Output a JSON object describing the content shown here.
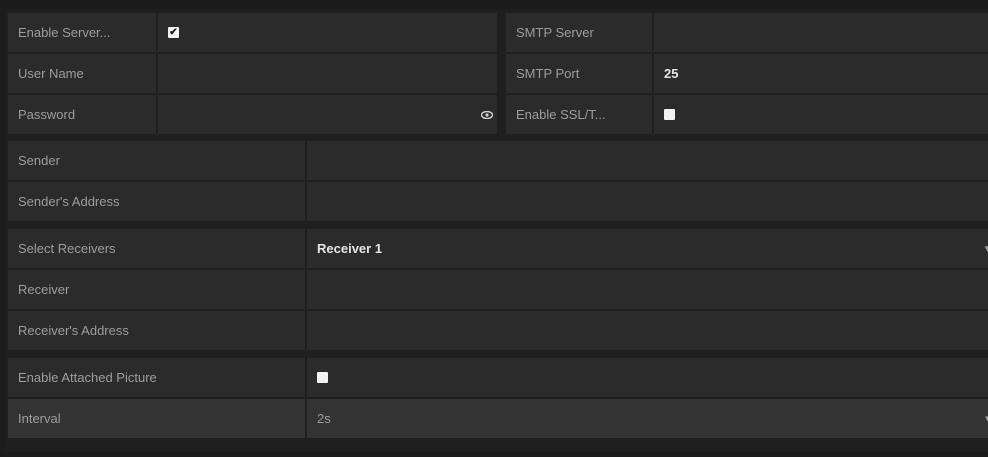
{
  "server": {
    "enable_auth_label": "Enable Server...",
    "enable_auth_checked": true,
    "user_name_label": "User Name",
    "user_name_value": "",
    "password_label": "Password",
    "password_value": "",
    "smtp_server_label": "SMTP Server",
    "smtp_server_value": "",
    "smtp_port_label": "SMTP Port",
    "smtp_port_value": "25",
    "enable_ssl_label": "Enable SSL/T...",
    "enable_ssl_checked": false
  },
  "sender": {
    "sender_label": "Sender",
    "sender_value": "",
    "sender_address_label": "Sender's Address",
    "sender_address_value": ""
  },
  "receivers": {
    "select_label": "Select Receivers",
    "selected_value": "Receiver 1",
    "receiver_label": "Receiver",
    "receiver_value": "",
    "receiver_address_label": "Receiver's Address",
    "receiver_address_value": ""
  },
  "attachment": {
    "enable_picture_label": "Enable Attached Picture",
    "enable_picture_checked": false,
    "interval_label": "Interval",
    "interval_value": "2s"
  },
  "icons": {
    "checkmark": "checkmark-icon",
    "eye": "eye-icon",
    "dropdown": "chevron-down-icon"
  }
}
